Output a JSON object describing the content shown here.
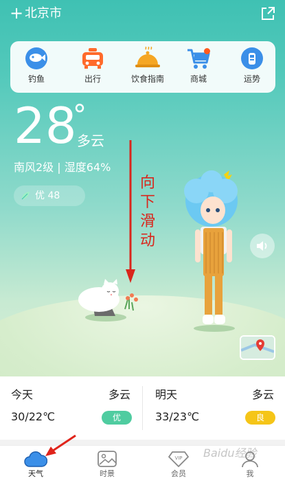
{
  "header": {
    "add_icon": "plus-icon",
    "city": "北京市",
    "share_icon": "share-icon"
  },
  "services": [
    {
      "label": "钓鱼",
      "icon": "fish-icon"
    },
    {
      "label": "出行",
      "icon": "car-icon"
    },
    {
      "label": "饮食指南",
      "icon": "food-cover-icon"
    },
    {
      "label": "商城",
      "icon": "shopping-cart-icon"
    },
    {
      "label": "运势",
      "icon": "fortune-icon"
    }
  ],
  "current": {
    "temperature": "28",
    "degree": "°",
    "condition": "多云",
    "wind_humidity": "南风2级 | 湿度64%",
    "aqi": "优 48"
  },
  "annotation": {
    "swipe_hint": [
      "向",
      "下",
      "滑",
      "动"
    ]
  },
  "forecast": {
    "today": {
      "day": "今天",
      "condition": "多云",
      "range": "30/22℃",
      "quality": "优",
      "quality_color": "#4fcca0"
    },
    "tomorrow": {
      "day": "明天",
      "condition": "多云",
      "range": "33/23℃",
      "quality": "良",
      "quality_color": "#f5c518"
    }
  },
  "tabs": [
    {
      "label": "天气",
      "icon": "cloud-icon",
      "active": true
    },
    {
      "label": "时景",
      "icon": "picture-icon",
      "active": false
    },
    {
      "label": "会员",
      "icon": "vip-diamond-icon",
      "active": false
    },
    {
      "label": "我",
      "icon": "user-icon",
      "active": false
    }
  ],
  "watermark": "Baidu经验",
  "colors": {
    "accent": "#3b8fe8",
    "hero_top": "#3fc1b3",
    "annotation_red": "#d9261c"
  }
}
